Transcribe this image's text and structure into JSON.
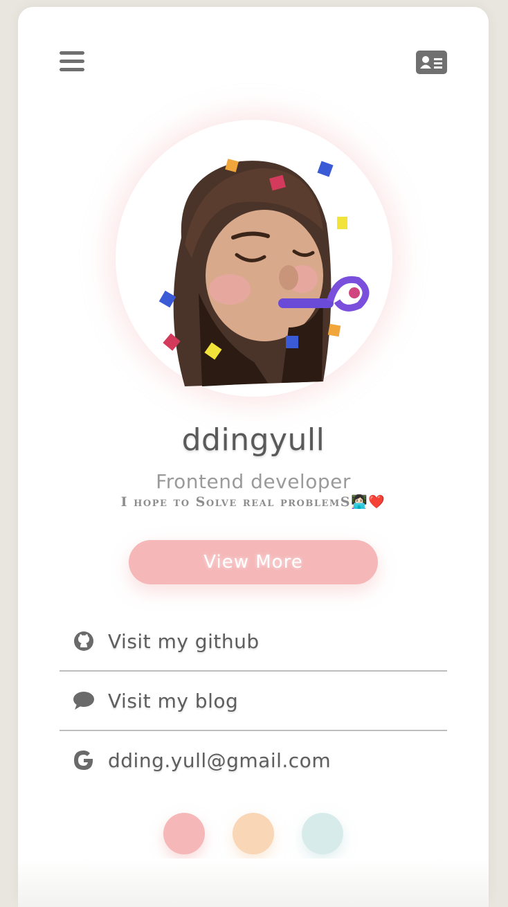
{
  "profile": {
    "name": "ddingyull",
    "role": "Frontend developer",
    "tagline": "I hope to Solve real problemS",
    "tagline_emoji": "👩🏻‍💻❤️"
  },
  "actions": {
    "view_more_label": "View More"
  },
  "links": [
    {
      "icon": "github-icon",
      "label": "Visit my github"
    },
    {
      "icon": "chat-bubble-icon",
      "label": "Visit my blog"
    },
    {
      "icon": "google-icon",
      "label": "dding.yull@gmail.com"
    }
  ],
  "header": {
    "left_icon": "hamburger-menu-icon",
    "right_icon": "contact-card-icon"
  },
  "theme_dots": [
    {
      "color": "#f5b7b8"
    },
    {
      "color": "#f8d6b6"
    },
    {
      "color": "#d8ebeb"
    }
  ],
  "colors": {
    "accent": "#f5b7b8",
    "text": "#5a5a5a",
    "muted": "#9a9a9a"
  }
}
